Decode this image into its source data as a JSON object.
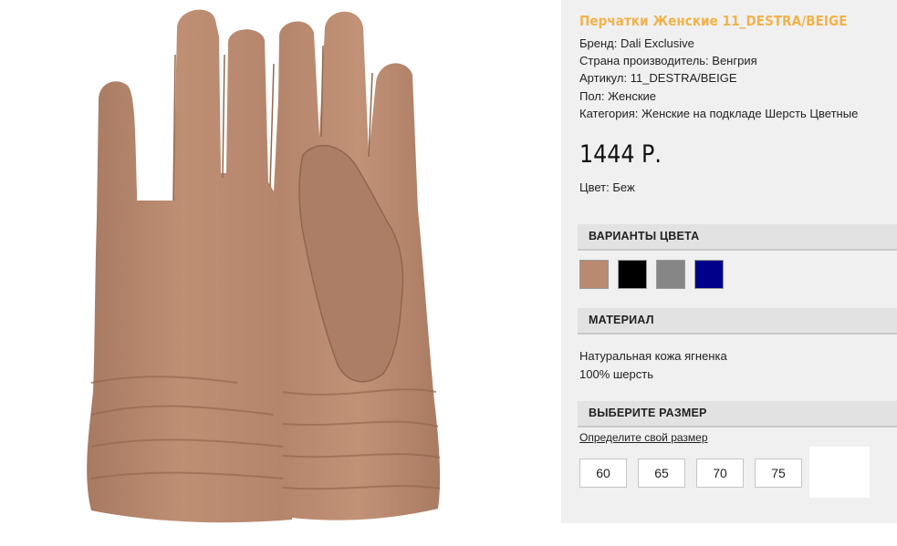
{
  "product": {
    "title": "Перчатки Женские 11_DESTRA/BEIGE",
    "brand": "Бренд: Dali Exclusive",
    "country": "Страна производитель: Венгрия",
    "article": "Артикул: 11_DESTRA/BEIGE",
    "gender": "Пол: Женские",
    "category": "Категория: Женские на подкладе Шерсть Цветные",
    "price": "1444 Р.",
    "color": "Цвет: Беж"
  },
  "colors_section": {
    "heading": "ВАРИАНТЫ ЦВЕТА",
    "swatches": [
      {
        "name": "beige",
        "hex": "#b98a70"
      },
      {
        "name": "black",
        "hex": "#000000"
      },
      {
        "name": "grey",
        "hex": "#868686"
      },
      {
        "name": "blue",
        "hex": "#00008b"
      }
    ]
  },
  "material_section": {
    "heading": "МАТЕРИАЛ",
    "lines": [
      "Натуральная кожа ягненка",
      "100% шерсть"
    ]
  },
  "size_section": {
    "heading": "ВЫБЕРИТЕ РАЗМЕР",
    "link": "Определите свой размер",
    "sizes": [
      "60",
      "65",
      "70",
      "75"
    ]
  },
  "theme": {
    "title_color": "#f2b24a",
    "glove_color": "#b98a70"
  }
}
